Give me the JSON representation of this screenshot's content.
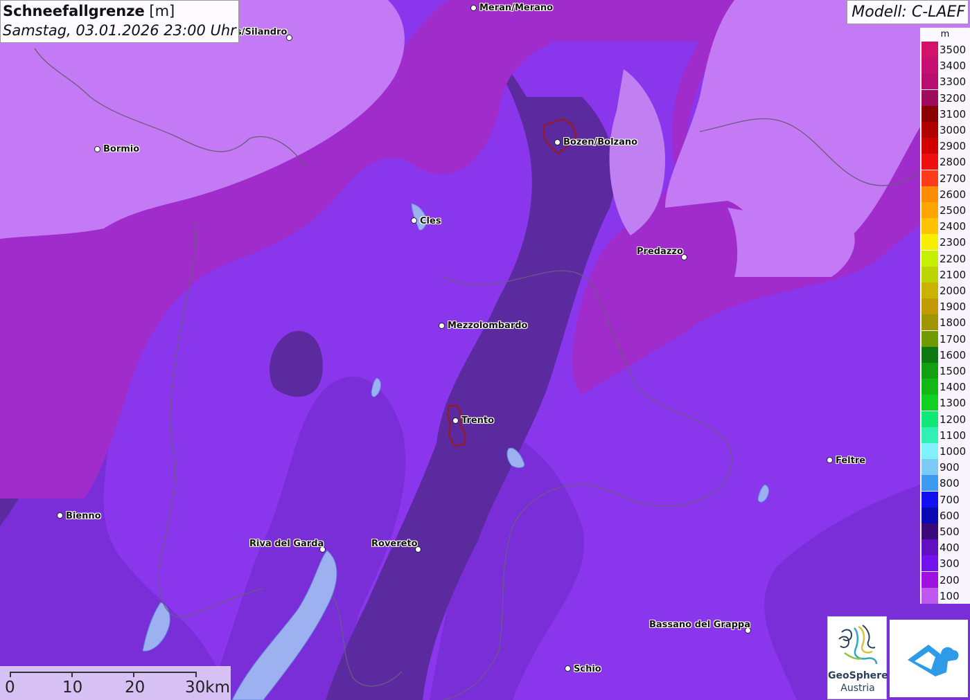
{
  "title": {
    "label": "Schneefallgrenze",
    "unit": "[m]",
    "datetime": "Samstag, 03.01.2026 23:00 Uhr"
  },
  "model": "Modell: C-LAEF",
  "legend": {
    "unit": "m",
    "levels": [
      {
        "label": "3500",
        "color": "#d1136a"
      },
      {
        "label": "3400",
        "color": "#c60f72"
      },
      {
        "label": "3300",
        "color": "#b80d6e"
      },
      {
        "label": "3200",
        "color": "#9e0a5c"
      },
      {
        "label": "3100",
        "color": "#8a0000"
      },
      {
        "label": "3000",
        "color": "#b00000"
      },
      {
        "label": "2900",
        "color": "#d00000"
      },
      {
        "label": "2800",
        "color": "#ee1010"
      },
      {
        "label": "2700",
        "color": "#ff3a1a"
      },
      {
        "label": "2600",
        "color": "#ff8c00"
      },
      {
        "label": "2500",
        "color": "#ffa500"
      },
      {
        "label": "2400",
        "color": "#ffc200"
      },
      {
        "label": "2300",
        "color": "#f6f000"
      },
      {
        "label": "2200",
        "color": "#c6f000"
      },
      {
        "label": "2100",
        "color": "#bcd400"
      },
      {
        "label": "2000",
        "color": "#c8b400"
      },
      {
        "label": "1900",
        "color": "#c09a00"
      },
      {
        "label": "1800",
        "color": "#a09400"
      },
      {
        "label": "1700",
        "color": "#6f9a00"
      },
      {
        "label": "1600",
        "color": "#0c7a10"
      },
      {
        "label": "1500",
        "color": "#12a012"
      },
      {
        "label": "1400",
        "color": "#14b814"
      },
      {
        "label": "1300",
        "color": "#10d020"
      },
      {
        "label": "1200",
        "color": "#10e87a"
      },
      {
        "label": "1100",
        "color": "#30f0b4"
      },
      {
        "label": "1000",
        "color": "#7ef2f8"
      },
      {
        "label": "900",
        "color": "#7ccaf6"
      },
      {
        "label": "800",
        "color": "#3c9af0"
      },
      {
        "label": "700",
        "color": "#1010f0"
      },
      {
        "label": "600",
        "color": "#0a0ab4"
      },
      {
        "label": "500",
        "color": "#3a0a7a"
      },
      {
        "label": "400",
        "color": "#6010c0"
      },
      {
        "label": "300",
        "color": "#7410ee"
      },
      {
        "label": "200",
        "color": "#a010de"
      },
      {
        "label": "100",
        "color": "#c058f0"
      }
    ]
  },
  "cities": [
    {
      "name": "Meran/Merano"
    },
    {
      "name": "s/Silandro"
    },
    {
      "name": "Bormio"
    },
    {
      "name": "Bozen/Bolzano"
    },
    {
      "name": "Cles"
    },
    {
      "name": "Predazzo"
    },
    {
      "name": "Mezzolombardo"
    },
    {
      "name": "Trento"
    },
    {
      "name": "Feltre"
    },
    {
      "name": "Bienno"
    },
    {
      "name": "Riva del Garda"
    },
    {
      "name": "Rovereto"
    },
    {
      "name": "Bassano del Grappa"
    },
    {
      "name": "Schio"
    }
  ],
  "scale": {
    "labels": [
      "0",
      "10",
      "20",
      "30km"
    ]
  },
  "logos": {
    "geosphere_name": "GeoSphere",
    "geosphere_country": "Austria",
    "geosphere_icon": "geosphere-logo",
    "partner_icon": "cloud-house-logo"
  }
}
